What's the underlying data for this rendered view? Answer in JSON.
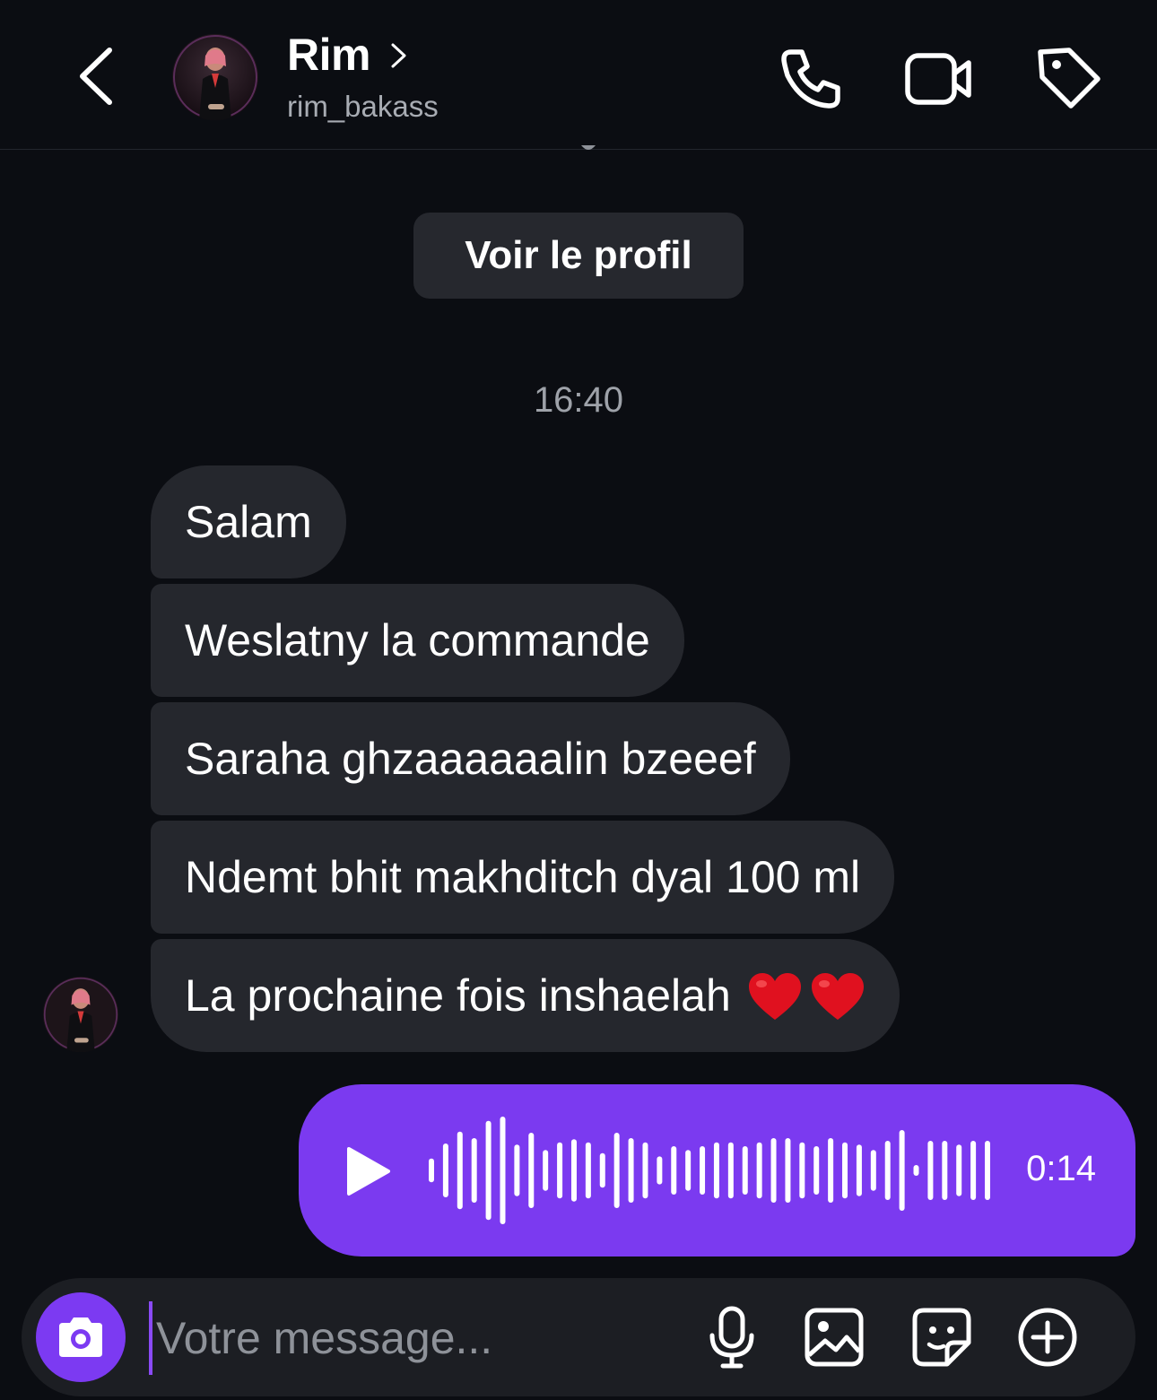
{
  "header": {
    "contact_name": "Rim",
    "contact_handle": "rim_bakass",
    "icons": [
      "back-icon",
      "chevron-right-icon",
      "phone-icon",
      "video-camera-icon",
      "tag-icon"
    ]
  },
  "profile_button_label": "Voir le profil",
  "timestamp": "16:40",
  "messages": [
    {
      "text": "Salam"
    },
    {
      "text": "Weslatny la commande"
    },
    {
      "text": "Saraha ghzaaaaaalin bzeeef"
    },
    {
      "text": "Ndemt bhit makhditch dyal 100 ml"
    },
    {
      "text": "La prochaine fois inshaelah",
      "emoji": "❤️❤️"
    }
  ],
  "voice_message": {
    "duration": "0:14",
    "bar_levels": [
      0.22,
      0.5,
      0.72,
      0.6,
      0.92,
      1.0,
      0.48,
      0.7,
      0.38,
      0.52,
      0.58,
      0.52,
      0.32,
      0.7,
      0.6,
      0.52,
      0.26,
      0.45,
      0.38,
      0.45,
      0.52,
      0.52,
      0.45,
      0.52,
      0.6,
      0.6,
      0.52,
      0.45,
      0.6,
      0.52,
      0.48,
      0.38,
      0.55,
      0.75,
      0.1,
      0.55,
      0.55,
      0.48,
      0.55,
      0.55
    ],
    "bg_color": "#7b3af0"
  },
  "composer": {
    "placeholder": "Votre message...",
    "icons": [
      "camera-icon",
      "microphone-icon",
      "gallery-icon",
      "sticker-icon",
      "plus-circle-icon"
    ],
    "accent_color": "#7c3af2"
  }
}
